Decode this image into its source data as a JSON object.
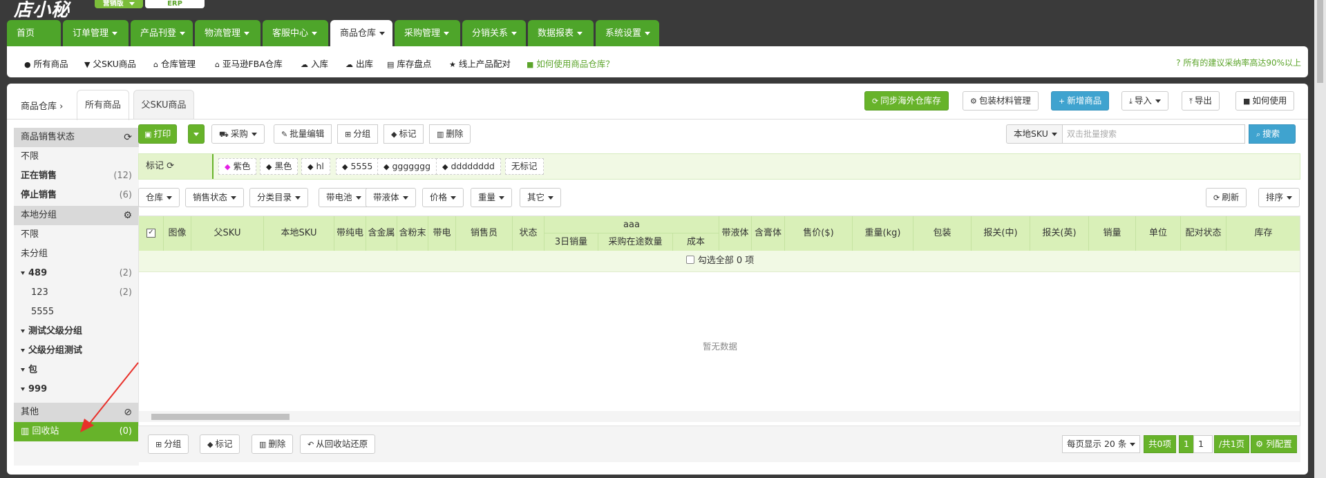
{
  "brand": {
    "logo": "店小秘",
    "edition": "营销版",
    "erp": "ERP"
  },
  "nav": [
    {
      "label": "首页",
      "has_caret": false
    },
    {
      "label": "订单管理",
      "has_caret": true
    },
    {
      "label": "产品刊登",
      "has_caret": true
    },
    {
      "label": "物流管理",
      "has_caret": true
    },
    {
      "label": "客服中心",
      "has_caret": true
    },
    {
      "label": "商品仓库",
      "has_caret": true,
      "active": true
    },
    {
      "label": "采购管理",
      "has_caret": true
    },
    {
      "label": "分销关系",
      "has_caret": true
    },
    {
      "label": "数据报表",
      "has_caret": true
    },
    {
      "label": "系统设置",
      "has_caret": true
    }
  ],
  "subnav": [
    {
      "icon": "●",
      "label": "所有商品"
    },
    {
      "icon": "▼",
      "label": "父SKU商品"
    },
    {
      "icon": "⌂",
      "label": "仓库管理"
    },
    {
      "icon": "⌂",
      "label": "亚马逊FBA仓库"
    },
    {
      "icon": "☁",
      "label": "入库"
    },
    {
      "icon": "☁",
      "label": "出库"
    },
    {
      "icon": "▤",
      "label": "库存盘点"
    },
    {
      "icon": "★",
      "label": "线上产品配对"
    },
    {
      "icon": "■",
      "label": "如何使用商品仓库？"
    }
  ],
  "notice": "所有的建议采纳率高达90%以上",
  "breadcrumb": {
    "root": "商品仓库",
    "sep": "›"
  },
  "tabs": [
    "所有商品",
    "父SKU商品"
  ],
  "top_buttons": {
    "sync": "同步海外仓库存",
    "packaging": "包装材料管理",
    "add": "新增商品",
    "import": "导入",
    "export": "导出",
    "howto": "如何使用"
  },
  "toolbar": {
    "print": "打印",
    "purchase": "采购",
    "batch_edit": "批量编辑",
    "group": "分组",
    "mark": "标记",
    "delete": "删除",
    "sku_select": "本地SKU",
    "search_placeholder": "双击批量搜索",
    "search": "搜索"
  },
  "tag_bar": {
    "label": "标记",
    "tags": [
      {
        "label": "紫色",
        "color": "#e51ee5"
      },
      {
        "label": "黑色",
        "color": "#222222"
      },
      {
        "label": "hl",
        "color": "#222222"
      },
      {
        "label": "5555",
        "color": "#222222"
      },
      {
        "label": "ggggggg",
        "color": "#222222"
      },
      {
        "label": "dddddddd",
        "color": "#222222"
      },
      {
        "label": "无标记",
        "color": ""
      }
    ]
  },
  "filters": [
    "仓库",
    "销售状态",
    "分类目录",
    "带电池",
    "带液体",
    "价格",
    "重量",
    "其它"
  ],
  "refresh": "刷新",
  "sort": "排序",
  "sidebar": {
    "sale_status": {
      "title": "商品销售状态",
      "items": [
        {
          "label": "不限",
          "count": ""
        },
        {
          "label": "正在销售",
          "count": "(12)"
        },
        {
          "label": "停止销售",
          "count": "(6)"
        }
      ]
    },
    "local_group": {
      "title": "本地分组",
      "items": [
        {
          "label": "不限",
          "count": ""
        },
        {
          "label": "未分组",
          "count": ""
        },
        {
          "label": "489",
          "count": "(2)"
        },
        {
          "label": "123",
          "count": "(2)"
        },
        {
          "label": "5555",
          "count": ""
        },
        {
          "label": "测试父级分组",
          "count": ""
        },
        {
          "label": "父级分组测试",
          "count": ""
        },
        {
          "label": "包",
          "count": ""
        },
        {
          "label": "999",
          "count": ""
        }
      ]
    },
    "other": {
      "title": "其他",
      "recycle": {
        "label": "回收站",
        "count": "(0)"
      }
    }
  },
  "table": {
    "columns": [
      "图像",
      "父SKU",
      "本地SKU",
      "带纯电",
      "含金属",
      "含粉末",
      "带电",
      "销售员",
      "状态"
    ],
    "group_title": "aaa",
    "group_columns": [
      "3日销量",
      "采购在途数量",
      "成本"
    ],
    "columns_after": [
      "带液体",
      "含膏体",
      "售价($)",
      "重量(kg)",
      "包装",
      "报关(中)",
      "报关(英)",
      "销量",
      "单位",
      "配对状态",
      "库存"
    ],
    "select_all": "勾选全部 0 项",
    "empty": "暂无数据"
  },
  "footer": {
    "group": "分组",
    "mark": "标记",
    "delete": "删除",
    "restore": "从回收站还原",
    "per_page": "每页显示 20 条",
    "total": "共0项",
    "page_current": "1",
    "page_input": "1",
    "page_total": "/共1页",
    "column_config": "列配置"
  }
}
